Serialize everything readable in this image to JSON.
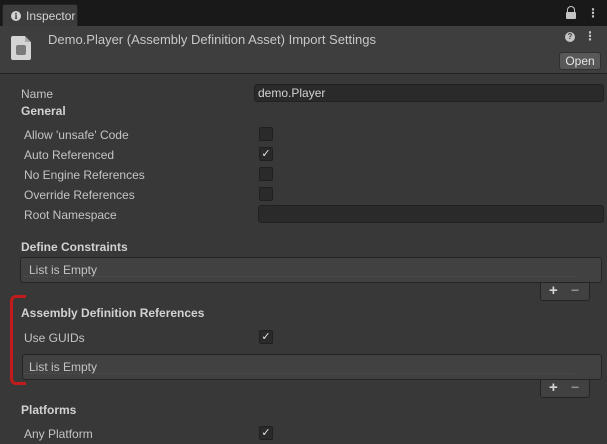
{
  "tab": {
    "label": "Inspector"
  },
  "header": {
    "title": "Demo.Player (Assembly Definition Asset) Import Settings",
    "open_label": "Open"
  },
  "fields": {
    "name_label": "Name",
    "name_value": "demo.Player"
  },
  "sections": {
    "general": {
      "title": "General",
      "rows": [
        {
          "label": "Allow 'unsafe' Code",
          "checked": false
        },
        {
          "label": "Auto Referenced",
          "checked": true
        },
        {
          "label": "No Engine References",
          "checked": false
        },
        {
          "label": "Override References",
          "checked": false
        },
        {
          "label": "Root Namespace",
          "value": ""
        }
      ]
    },
    "define_constraints": {
      "title": "Define Constraints",
      "list_text": "List is Empty"
    },
    "assembly_refs": {
      "title": "Assembly Definition References",
      "use_guids_label": "Use GUIDs",
      "use_guids_checked": true,
      "list_text": "List is Empty"
    },
    "platforms": {
      "title": "Platforms",
      "any_platform_label": "Any Platform",
      "any_platform_checked": true
    }
  },
  "list_buttons": {
    "plus": "+",
    "minus": "−"
  },
  "icons": {
    "tab": "info-icon",
    "lock": "lock-icon",
    "menu": "kebab-menu-icon",
    "help": "help-icon",
    "asset": "assembly-definition-icon"
  },
  "colors": {
    "annotation": "#c21b1b",
    "check": "#e6e6e6"
  },
  "glyphs": {
    "check": "✓",
    "info": "i",
    "help": "?",
    "kebab": "⋮"
  }
}
